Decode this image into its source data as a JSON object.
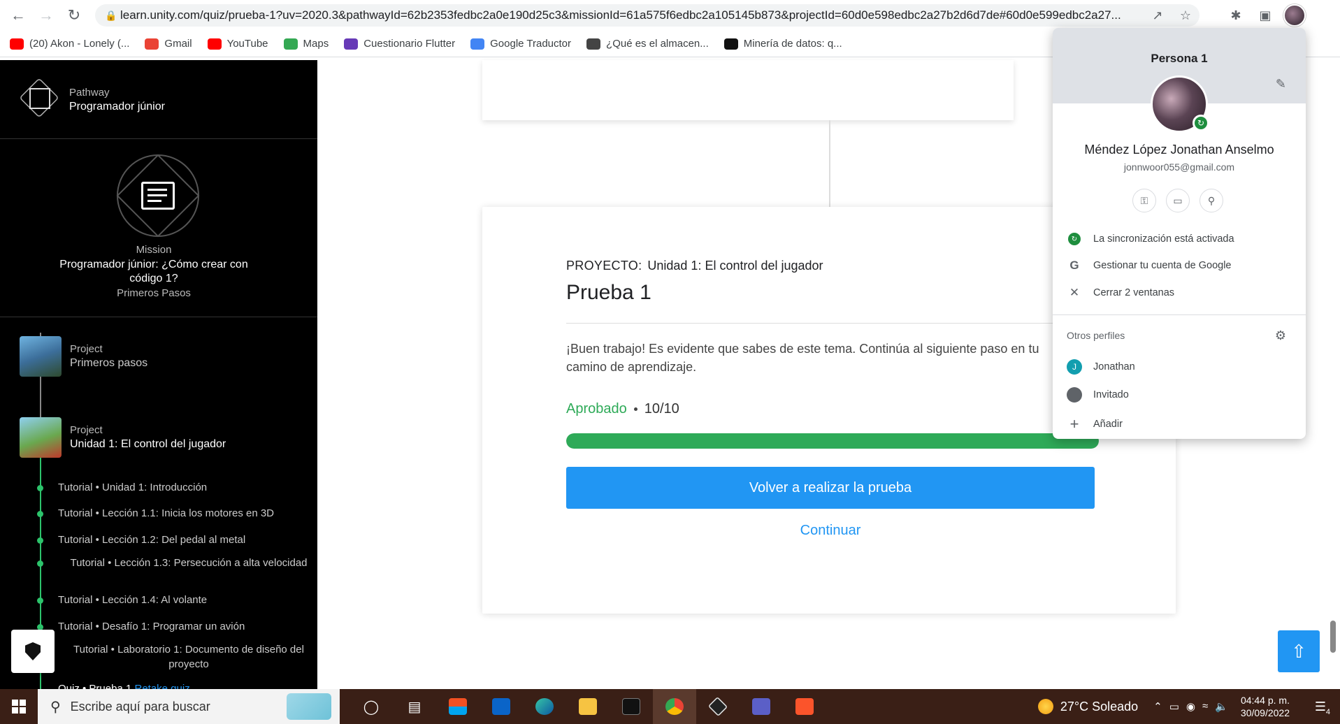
{
  "browser": {
    "url": "learn.unity.com/quiz/prueba-1?uv=2020.3&pathwayId=62b2353fedbc2a0e190d25c3&missionId=61a575f6edbc2a105145b873&projectId=60d0e598edbc2a27b2d6d7de#60d0e599edbc2a27...",
    "bookmarks": [
      {
        "label": "(20) Akon - Lonely (...",
        "color": "#ff0000"
      },
      {
        "label": "Gmail",
        "color": "#ea4335"
      },
      {
        "label": "YouTube",
        "color": "#ff0000"
      },
      {
        "label": "Maps",
        "color": "#34a853"
      },
      {
        "label": "Cuestionario Flutter",
        "color": "#673ab7"
      },
      {
        "label": "Google Traductor",
        "color": "#4285f4"
      },
      {
        "label": "¿Qué es el almacen...",
        "color": "#444444"
      },
      {
        "label": "Minería de datos: q...",
        "color": "#111111"
      }
    ]
  },
  "sidebar": {
    "pathway_label": "Pathway",
    "pathway_title": "Programador júnior",
    "mission_label": "Mission",
    "mission_title": "Programador júnior: ¿Cómo crear con código 1?",
    "mission_sub": "Primeros Pasos",
    "projects": [
      {
        "label": "Project",
        "name": "Primeros pasos"
      },
      {
        "label": "Project",
        "name": "Unidad 1: El control del jugador"
      }
    ],
    "tutorials": [
      "Tutorial • Unidad 1: Introducción",
      "Tutorial • Lección 1.1: Inicia los motores en 3D",
      "Tutorial • Lección 1.2: Del pedal al metal",
      "Tutorial • Lección 1.3: Persecución a alta velocidad",
      "Tutorial • Lección 1.4: Al volante",
      "Tutorial • Desafío 1: Programar un avión",
      "Tutorial • Laboratorio 1: Documento de diseño del proyecto"
    ],
    "quiz_item": "Quiz • Prueba 1",
    "quiz_link": "Retake quiz"
  },
  "quiz": {
    "project_key": "PROYECTO:",
    "project_name": "Unidad 1: El control del jugador",
    "title": "Prueba 1",
    "message": "¡Buen trabajo! Es evidente que sabes de este tema. Continúa al siguiente paso en tu camino de aprendizaje.",
    "status": "Aprobado",
    "score": "10/10",
    "progress_percent": 100,
    "retake_label": "Volver a realizar la prueba",
    "continue_label": "Continuar"
  },
  "profile_menu": {
    "persona": "Persona 1",
    "name": "Méndez López Jonathan Anselmo",
    "email": "jonnwoor055@gmail.com",
    "sync": "La sincronización está activada",
    "manage": "Gestionar tu cuenta de Google",
    "close_windows": "Cerrar 2 ventanas",
    "other_profiles": "Otros perfiles",
    "profiles": [
      "Jonathan",
      "Invitado"
    ],
    "add": "Añadir",
    "j_initial": "J"
  },
  "taskbar": {
    "search_placeholder": "Escribe aquí para buscar",
    "weather": "27°C  Soleado",
    "time": "04:44 p. m.",
    "date": "30/09/2022",
    "notifications": "4"
  }
}
